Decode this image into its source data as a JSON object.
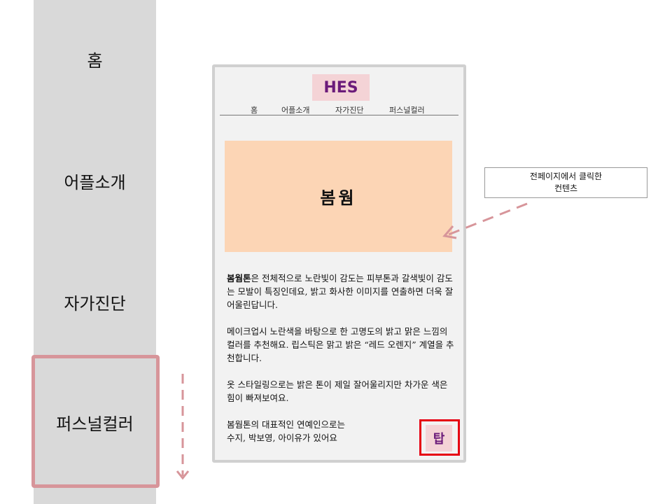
{
  "left_nav": {
    "items": [
      {
        "label": "홈"
      },
      {
        "label": "어플소개"
      },
      {
        "label": "자가진단"
      },
      {
        "label": "퍼스널컬러"
      }
    ]
  },
  "phone": {
    "logo": "HES",
    "nav": [
      "홈",
      "어플소개",
      "자가진단",
      "퍼스널컬러"
    ],
    "hero_title": "봄웜",
    "description": {
      "p1_bold": "봄웜톤",
      "p1_rest": "은 전체적으로 노란빛이 감도는 피부톤과 갈색빛이 감도는 모발이 특징인데요, 밝고 화사한 이미지를 연출하면 더욱 잘어울린답니다.",
      "p2": "메이크업시 노란색을 바탕으로 한 고명도의 밝고 맑은 느낌의 컬러를 추천해요. 립스틱은 맑고 밝은 “레드 오렌지” 계열을 추천합니다.",
      "p3": "옷 스타일링으로는 밝은 톤이 제일 잘어울리지만 차가운 색은 힘이 빠져보여요.",
      "p4_line1": "봄웜톤의 대표적인 연예인으로는",
      "p4_line2": "수지, 박보영, 아이유가 있어요"
    },
    "top_button": "탑"
  },
  "annotation": {
    "line1": "전페이지에서 클릭한",
    "line2": "컨텐츠"
  },
  "colors": {
    "left_nav_bg": "#d9d9d9",
    "highlight": "#d7959a",
    "logo_bg": "#f4d3d6",
    "logo_text": "#6b1b7a",
    "hero_bg": "#fcd5b5",
    "top_button_border": "#e60012"
  }
}
